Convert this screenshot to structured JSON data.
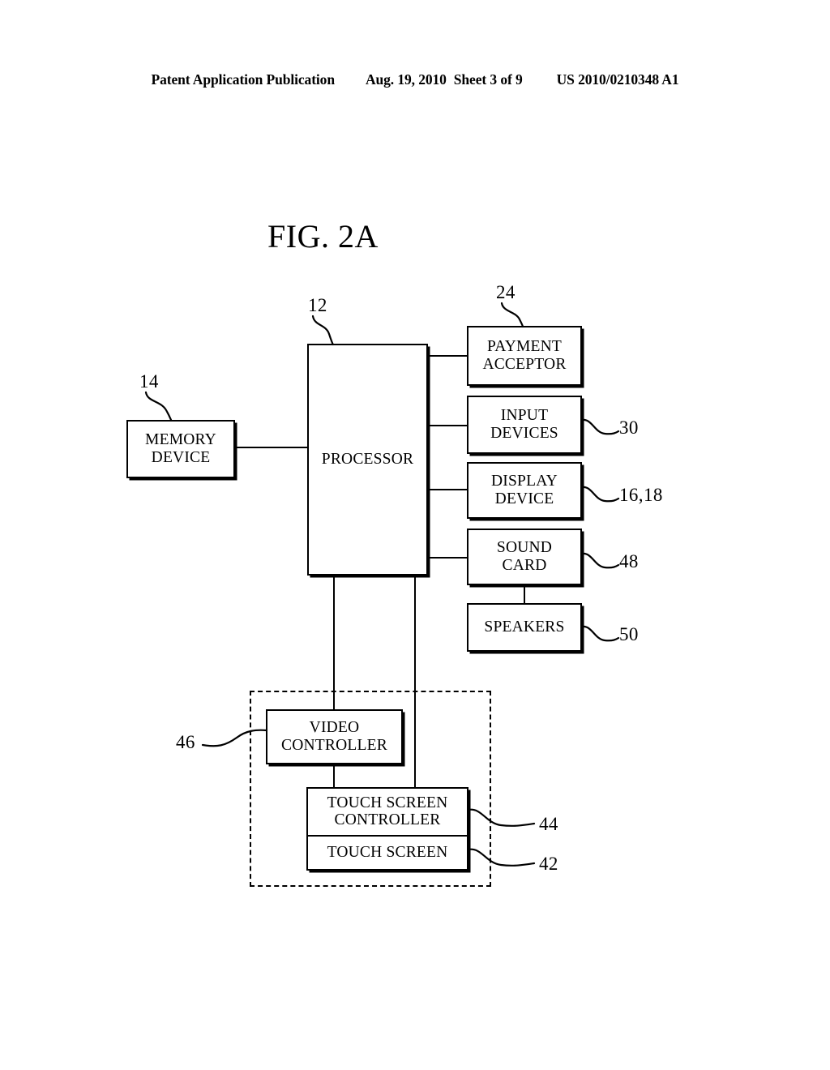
{
  "header": {
    "publication": "Patent Application Publication",
    "date": "Aug. 19, 2010",
    "sheet": "Sheet 3 of 9",
    "patent_number": "US 2010/0210348 A1"
  },
  "figure": {
    "title": "FIG. 2A"
  },
  "blocks": {
    "processor": {
      "label": "PROCESSOR",
      "ref": "12"
    },
    "memory_device": {
      "line1": "MEMORY",
      "line2": "DEVICE",
      "ref": "14"
    },
    "payment_acceptor": {
      "line1": "PAYMENT",
      "line2": "ACCEPTOR",
      "ref": "24"
    },
    "input_devices": {
      "line1": "INPUT",
      "line2": "DEVICES",
      "ref": "30"
    },
    "display_device": {
      "line1": "DISPLAY",
      "line2": "DEVICE",
      "ref": "16,18"
    },
    "sound_card": {
      "line1": "SOUND",
      "line2": "CARD",
      "ref": "48"
    },
    "speakers": {
      "label": "SPEAKERS",
      "ref": "50"
    },
    "video_controller": {
      "line1": "VIDEO",
      "line2": "CONTROLLER",
      "ref": "46"
    },
    "touch_screen_controller": {
      "line1": "TOUCH SCREEN",
      "line2": "CONTROLLER",
      "ref": "44"
    },
    "touch_screen": {
      "label": "TOUCH SCREEN",
      "ref": "42"
    }
  },
  "colors": {
    "ink": "#000000",
    "paper": "#ffffff"
  }
}
